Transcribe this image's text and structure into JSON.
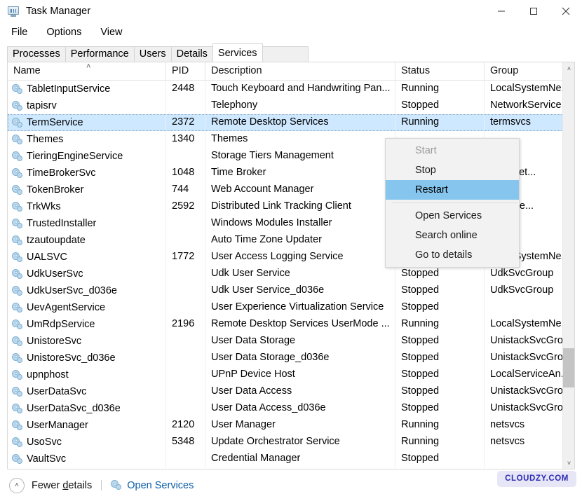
{
  "window": {
    "title": "Task Manager",
    "icon": "task-manager-icon",
    "buttons": {
      "minimize": "—",
      "maximize": "□",
      "close": "✕"
    }
  },
  "menubar": {
    "items": [
      {
        "label": "File"
      },
      {
        "label": "Options"
      },
      {
        "label": "View"
      }
    ]
  },
  "tabs": [
    {
      "label": "Processes",
      "active": false
    },
    {
      "label": "Performance",
      "active": false
    },
    {
      "label": "Users",
      "active": false
    },
    {
      "label": "Details",
      "active": false
    },
    {
      "label": "Services",
      "active": true
    }
  ],
  "table": {
    "sort_indicator": "˄",
    "columns": [
      {
        "key": "name",
        "label": "Name"
      },
      {
        "key": "pid",
        "label": "PID"
      },
      {
        "key": "description",
        "label": "Description"
      },
      {
        "key": "status",
        "label": "Status"
      },
      {
        "key": "group",
        "label": "Group"
      }
    ],
    "rows": [
      {
        "name": "TabletInputService",
        "pid": "2448",
        "description": "Touch Keyboard and Handwriting Pan...",
        "status": "Running",
        "group": "LocalSystemNe...",
        "selected": false
      },
      {
        "name": "tapisrv",
        "pid": "",
        "description": "Telephony",
        "status": "Stopped",
        "group": "NetworkService",
        "selected": false
      },
      {
        "name": "TermService",
        "pid": "2372",
        "description": "Remote Desktop Services",
        "status": "Running",
        "group": "termsvcs",
        "selected": true
      },
      {
        "name": "Themes",
        "pid": "1340",
        "description": "Themes",
        "status": "",
        "group": "",
        "selected": false
      },
      {
        "name": "TieringEngineService",
        "pid": "",
        "description": "Storage Tiers Management",
        "status": "",
        "group": "",
        "selected": false
      },
      {
        "name": "TimeBrokerSvc",
        "pid": "1048",
        "description": "Time Broker",
        "status": "",
        "group": "rviceNet...",
        "selected": false
      },
      {
        "name": "TokenBroker",
        "pid": "744",
        "description": "Web Account Manager",
        "status": "",
        "group": "",
        "selected": false
      },
      {
        "name": "TrkWks",
        "pid": "2592",
        "description": "Distributed Link Tracking Client",
        "status": "",
        "group": "stemNe...",
        "selected": false
      },
      {
        "name": "TrustedInstaller",
        "pid": "",
        "description": "Windows Modules Installer",
        "status": "",
        "group": "",
        "selected": false
      },
      {
        "name": "tzautoupdate",
        "pid": "",
        "description": "Auto Time Zone Updater",
        "status": "",
        "group": "rvice",
        "selected": false
      },
      {
        "name": "UALSVC",
        "pid": "1772",
        "description": "User Access Logging Service",
        "status": "Running",
        "group": "LocalSystemNe...",
        "selected": false
      },
      {
        "name": "UdkUserSvc",
        "pid": "",
        "description": "Udk User Service",
        "status": "Stopped",
        "group": "UdkSvcGroup",
        "selected": false
      },
      {
        "name": "UdkUserSvc_d036e",
        "pid": "",
        "description": "Udk User Service_d036e",
        "status": "Stopped",
        "group": "UdkSvcGroup",
        "selected": false
      },
      {
        "name": "UevAgentService",
        "pid": "",
        "description": "User Experience Virtualization Service",
        "status": "Stopped",
        "group": "",
        "selected": false
      },
      {
        "name": "UmRdpService",
        "pid": "2196",
        "description": "Remote Desktop Services UserMode ...",
        "status": "Running",
        "group": "LocalSystemNe...",
        "selected": false
      },
      {
        "name": "UnistoreSvc",
        "pid": "",
        "description": "User Data Storage",
        "status": "Stopped",
        "group": "UnistackSvcGro...",
        "selected": false
      },
      {
        "name": "UnistoreSvc_d036e",
        "pid": "",
        "description": "User Data Storage_d036e",
        "status": "Stopped",
        "group": "UnistackSvcGro...",
        "selected": false
      },
      {
        "name": "upnphost",
        "pid": "",
        "description": "UPnP Device Host",
        "status": "Stopped",
        "group": "LocalServiceAn...",
        "selected": false
      },
      {
        "name": "UserDataSvc",
        "pid": "",
        "description": "User Data Access",
        "status": "Stopped",
        "group": "UnistackSvcGro...",
        "selected": false
      },
      {
        "name": "UserDataSvc_d036e",
        "pid": "",
        "description": "User Data Access_d036e",
        "status": "Stopped",
        "group": "UnistackSvcGro...",
        "selected": false
      },
      {
        "name": "UserManager",
        "pid": "2120",
        "description": "User Manager",
        "status": "Running",
        "group": "netsvcs",
        "selected": false
      },
      {
        "name": "UsoSvc",
        "pid": "5348",
        "description": "Update Orchestrator Service",
        "status": "Running",
        "group": "netsvcs",
        "selected": false
      },
      {
        "name": "VaultSvc",
        "pid": "",
        "description": "Credential Manager",
        "status": "Stopped",
        "group": "",
        "selected": false
      }
    ]
  },
  "context_menu": {
    "items": [
      {
        "label": "Start",
        "state": "disabled"
      },
      {
        "label": "Stop",
        "state": "normal"
      },
      {
        "label": "Restart",
        "state": "highlight"
      },
      {
        "label": "__separator__",
        "state": "separator"
      },
      {
        "label": "Open Services",
        "state": "normal"
      },
      {
        "label": "Search online",
        "state": "normal"
      },
      {
        "label": "Go to details",
        "state": "normal"
      }
    ]
  },
  "statusbar": {
    "chevron": "˄",
    "fewer_details_pre": "Fewer ",
    "fewer_details_accel": "d",
    "fewer_details_post": "etails",
    "open_services": "Open Services"
  },
  "watermark": {
    "text": "CLOUDZY.COM"
  },
  "scrollbar": {
    "up_arrow": "˄",
    "down_arrow": "˅"
  },
  "colors": {
    "selection": "#cde8ff",
    "menu_highlight": "#86c5ee",
    "link": "#0a5ca8",
    "watermark_bg": "#e7e6f7",
    "watermark_text": "#2b2bb5"
  }
}
